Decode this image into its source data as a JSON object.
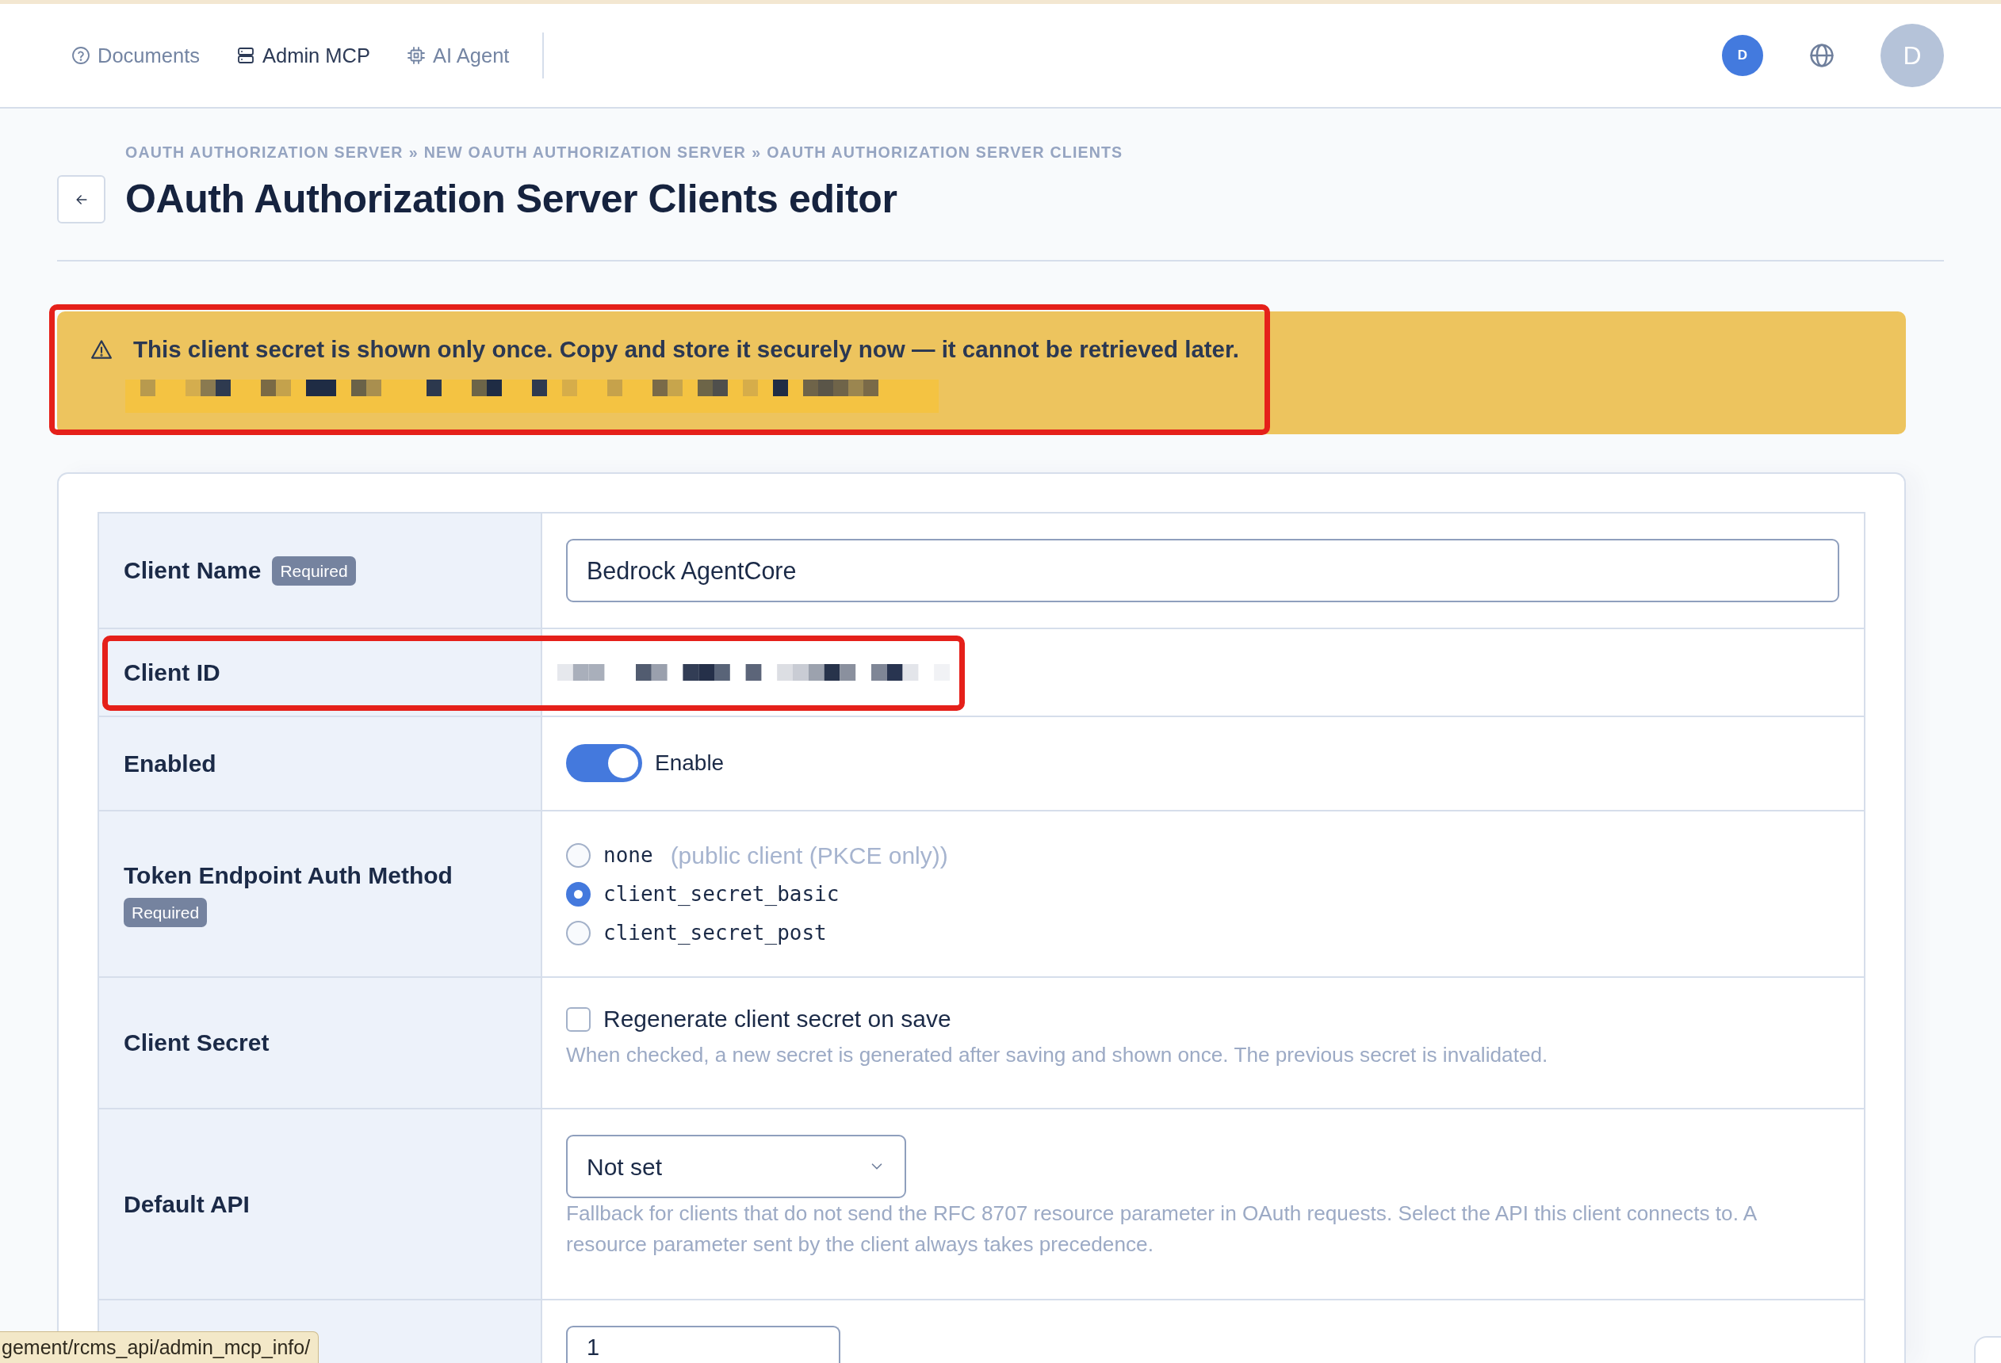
{
  "top_nav": {
    "items": [
      {
        "label": "Documents",
        "selected": false
      },
      {
        "label": "Admin MCP",
        "selected": true
      },
      {
        "label": "AI Agent",
        "selected": false
      }
    ],
    "site_badge": "D",
    "avatar": "D"
  },
  "breadcrumb": [
    {
      "label": "OAUTH AUTHORIZATION SERVER"
    },
    {
      "separator": "»",
      "label": "NEW OAUTH AUTHORIZATION SERVER"
    },
    {
      "separator": "»",
      "label": "OAUTH AUTHORIZATION SERVER CLIENTS"
    }
  ],
  "title": "OAuth Authorization Server Clients editor",
  "alert": {
    "message": "This client secret is shown only once. Copy and store it securely now — it cannot be retrieved later.",
    "highlighted": true
  },
  "form": {
    "fields": [
      {
        "kind": "text",
        "label": "Client Name",
        "badge": "Required",
        "value": "Bedrock AgentCore",
        "highlighted": false
      },
      {
        "kind": "redacted",
        "label": "Client ID",
        "highlighted": true
      },
      {
        "kind": "switch",
        "label": "Enabled",
        "on": true,
        "text": "Enable",
        "highlighted": false
      },
      {
        "kind": "radio",
        "label": "Token Endpoint Auth Method",
        "badge": "Required",
        "highlighted": false,
        "options": [
          {
            "label": "none",
            "note": "(public client (PKCE only))",
            "selected": false
          },
          {
            "label": "client_secret_basic",
            "selected": true
          },
          {
            "label": "client_secret_post",
            "selected": false
          }
        ]
      },
      {
        "kind": "checkbox",
        "label": "Client Secret",
        "checked": false,
        "text": "Regenerate client secret on save",
        "help": "When checked, a new secret is generated after saving and shown once. The previous secret is invalidated.",
        "highlighted": false
      },
      {
        "kind": "select",
        "label": "Default API",
        "value": "Not set",
        "help": "Fallback for clients that do not send the RFC 8707 resource parameter in OAuth requests. Select the API this client connects to. A resource parameter sent by the client always takes precedence.",
        "highlighted": false
      },
      {
        "kind": "number",
        "value": "1",
        "highlighted": false
      }
    ]
  },
  "status_url": "gement/rcms_api/admin_mcp_info/"
}
